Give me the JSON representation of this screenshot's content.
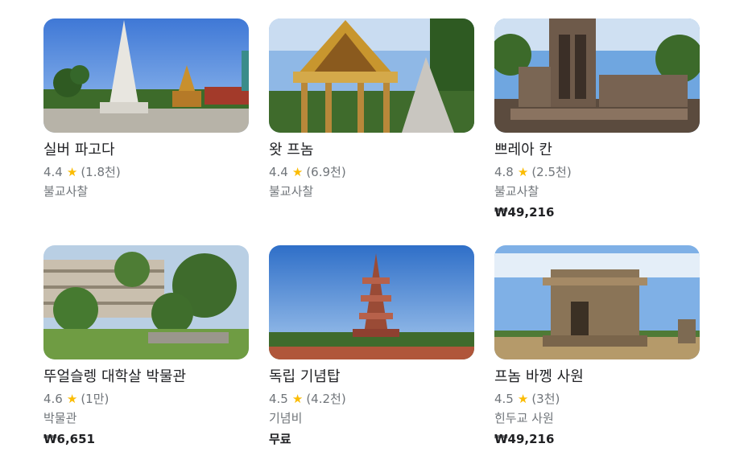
{
  "places": [
    {
      "title": "실버 파고다",
      "rating": "4.4",
      "reviews": "(1.8천)",
      "category": "불교사찰",
      "price": ""
    },
    {
      "title": "왓 프놈",
      "rating": "4.4",
      "reviews": "(6.9천)",
      "category": "불교사찰",
      "price": ""
    },
    {
      "title": "쁘레아 칸",
      "rating": "4.8",
      "reviews": "(2.5천)",
      "category": "불교사찰",
      "price": "₩49,216"
    },
    {
      "title": "뚜얼슬렝 대학살 박물관",
      "rating": "4.6",
      "reviews": "(1만)",
      "category": "박물관",
      "price": "₩6,651"
    },
    {
      "title": "독립 기념탑",
      "rating": "4.5",
      "reviews": "(4.2천)",
      "category": "기념비",
      "price": "무료"
    },
    {
      "title": "프놈 바껭 사원",
      "rating": "4.5",
      "reviews": "(3천)",
      "category": "힌두교 사원",
      "price": "₩49,216"
    }
  ],
  "icons": {
    "rating": "star-icon"
  },
  "colors": {
    "star": "#fbbc04",
    "title": "#202124",
    "meta": "#70757a"
  }
}
